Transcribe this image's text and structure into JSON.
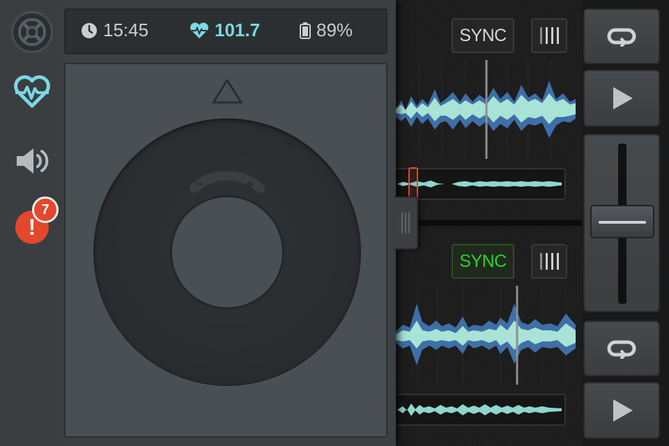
{
  "status_bar": {
    "time": "15:45",
    "bpm": "101.7",
    "battery": "89%"
  },
  "deck_a": {
    "sync_label": "SYNC",
    "sync_active": false
  },
  "deck_b": {
    "sync_label": "SYNC",
    "sync_active": true
  },
  "sidebar": {
    "items": [
      {
        "name": "heartbeat",
        "active": true
      },
      {
        "name": "volume",
        "active": false
      },
      {
        "name": "alerts",
        "active": false
      }
    ],
    "notification_count": "7",
    "alert_symbol": "!"
  },
  "jog": {
    "minus": "−",
    "plus": "+"
  },
  "colors": {
    "accent": "#7cd7e6",
    "wave_light": "#a8e3d6",
    "wave_dark": "#3f6fa8",
    "sync_active": "#2fd12f",
    "alert": "#e4472c"
  }
}
